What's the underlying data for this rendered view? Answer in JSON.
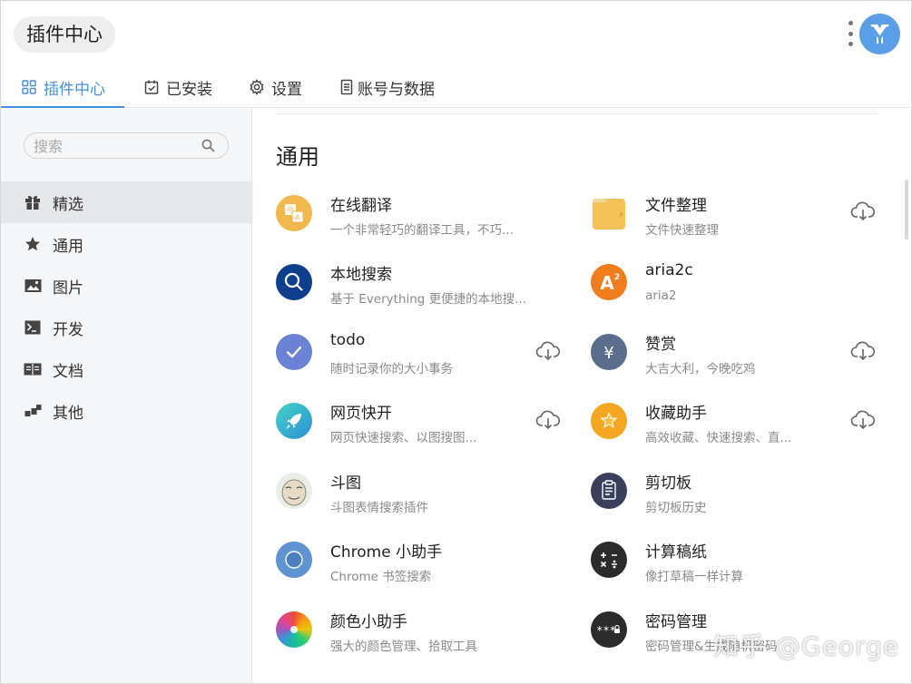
{
  "app": {
    "title": "插件中心"
  },
  "tabs": [
    {
      "label": "插件中心",
      "icon": "grid-icon"
    },
    {
      "label": "已安装",
      "icon": "calendar-check-icon"
    },
    {
      "label": "设置",
      "icon": "gear-icon"
    },
    {
      "label": "账号与数据",
      "icon": "ledger-icon"
    }
  ],
  "search": {
    "placeholder": "搜索"
  },
  "sidebar": {
    "items": [
      {
        "label": "精选",
        "icon": "gift-icon"
      },
      {
        "label": "通用",
        "icon": "star-icon"
      },
      {
        "label": "图片",
        "icon": "image-icon"
      },
      {
        "label": "开发",
        "icon": "terminal-icon"
      },
      {
        "label": "文档",
        "icon": "book-icon"
      },
      {
        "label": "其他",
        "icon": "blocks-icon"
      }
    ]
  },
  "main": {
    "section_title": "通用",
    "plugins_left": [
      {
        "name": "在线翻译",
        "desc": "一个非常轻巧的翻译工具，不巧...",
        "icon": "translate-icon",
        "color": "#f2b84b",
        "download": false
      },
      {
        "name": "本地搜索",
        "desc": "基于 Everything 更便捷的本地搜...",
        "icon": "magnifier-icon",
        "color": "#0e3f8c",
        "download": false
      },
      {
        "name": "todo",
        "desc": "随时记录你的大小事务",
        "icon": "check-icon",
        "color": "#6b82d4",
        "download": true
      },
      {
        "name": "网页快开",
        "desc": "网页快速搜索、以图搜图...",
        "icon": "rocket-icon",
        "color": "#3cc4c0",
        "download": true
      },
      {
        "name": "斗图",
        "desc": "斗图表情搜索插件",
        "icon": "meme-face-icon",
        "color": "#e9efe6",
        "download": false
      },
      {
        "name": "Chrome 小助手",
        "desc": "Chrome 书签搜索",
        "icon": "chrome-circle-icon",
        "color": "#5a8fcf",
        "download": false
      },
      {
        "name": "颜色小助手",
        "desc": "强大的颜色管理、拾取工具",
        "icon": "color-wheel-icon",
        "color": "#e94b3c",
        "download": false
      }
    ],
    "plugins_right": [
      {
        "name": "文件整理",
        "desc": "文件快速整理",
        "icon": "folder-icon",
        "color": "#f5c25a",
        "download": true
      },
      {
        "name": "aria2c",
        "desc": "aria2",
        "icon": "aria-icon",
        "color": "#f07d1e",
        "download": false
      },
      {
        "name": "赞赏",
        "desc": "大吉大利，今晚吃鸡",
        "icon": "yen-icon",
        "color": "#5b6d8a",
        "download": true
      },
      {
        "name": "收藏助手",
        "desc": "高效收藏、快速搜索、直...",
        "icon": "star-badge-icon",
        "color": "#f5a623",
        "download": true
      },
      {
        "name": "剪切板",
        "desc": "剪切板历史",
        "icon": "clipboard-icon",
        "color": "#3a3f5c",
        "download": false
      },
      {
        "name": "计算稿纸",
        "desc": "像打草稿一样计算",
        "icon": "calculator-icon",
        "color": "#2b2b2b",
        "download": false
      },
      {
        "name": "密码管理",
        "desc": "密码管理&生成随机密码",
        "icon": "password-icon",
        "color": "#2b2b2b",
        "download": false
      }
    ]
  },
  "watermark": {
    "text": "知乎 @George"
  },
  "colors": {
    "accent": "#4a90d9",
    "sidebar_bg": "#f5f6f8",
    "active_item_bg": "#e6e7ea"
  }
}
